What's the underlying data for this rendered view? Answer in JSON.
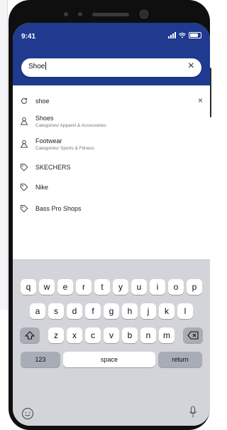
{
  "status": {
    "time": "9:41"
  },
  "search": {
    "value": "Shoe",
    "clear": "×"
  },
  "suggestions": [
    {
      "type": "recent",
      "label": "shoe",
      "remove": "×",
      "icon": "history-icon"
    },
    {
      "type": "category",
      "label": "Shoes",
      "subtitle": "Categories/ Apparel & Accessories",
      "icon": "category-icon"
    },
    {
      "type": "category",
      "label": "Footwear",
      "subtitle": "Categories/ Sports & Fitness",
      "icon": "category-icon"
    },
    {
      "type": "brand",
      "label": "SKECHERS",
      "icon": "tag-icon"
    },
    {
      "type": "brand",
      "label": "Nike",
      "icon": "tag-icon"
    },
    {
      "type": "brand",
      "label": "Bass Pro Shops",
      "icon": "tag-icon"
    }
  ],
  "keyboard": {
    "row1": [
      "q",
      "w",
      "e",
      "r",
      "t",
      "y",
      "u",
      "i",
      "o",
      "p"
    ],
    "row2": [
      "a",
      "s",
      "d",
      "f",
      "g",
      "h",
      "j",
      "k",
      "l"
    ],
    "row3": [
      "z",
      "x",
      "c",
      "v",
      "b",
      "n",
      "m"
    ],
    "numbers": "123",
    "space": "space",
    "return": "return"
  },
  "colors": {
    "header": "#1f3a8f"
  }
}
